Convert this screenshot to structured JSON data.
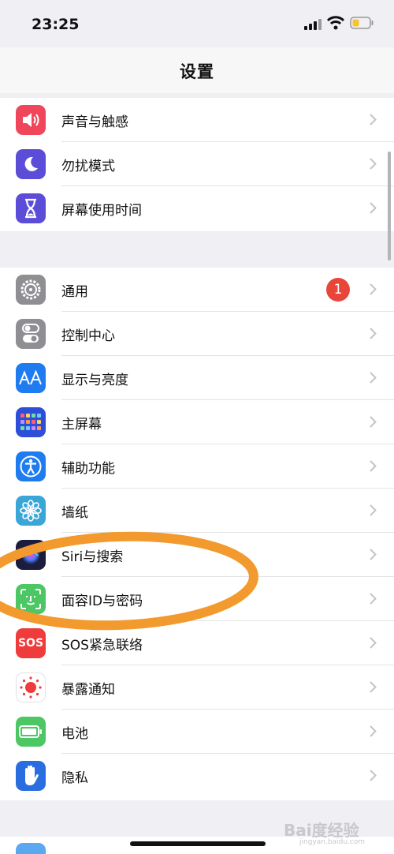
{
  "status_bar": {
    "time": "23:25"
  },
  "nav": {
    "title": "设置"
  },
  "group1": [
    {
      "label": "声音与触感",
      "icon": "speaker-icon",
      "color": "#f0465b"
    },
    {
      "label": "勿扰模式",
      "icon": "moon-icon",
      "color": "#5b4dd8"
    },
    {
      "label": "屏幕使用时间",
      "icon": "hourglass-icon",
      "color": "#5b4dd8"
    }
  ],
  "group2": [
    {
      "label": "通用",
      "icon": "gear-icon",
      "color": "#8e8e93",
      "badge": "1"
    },
    {
      "label": "控制中心",
      "icon": "toggles-icon",
      "color": "#8e8e93"
    },
    {
      "label": "显示与亮度",
      "icon": "text-size-icon",
      "color": "#1e7cf0"
    },
    {
      "label": "主屏幕",
      "icon": "app-grid-icon",
      "color": "#2d4ed8"
    },
    {
      "label": "辅助功能",
      "icon": "accessibility-icon",
      "color": "#1e7cf0"
    },
    {
      "label": "墙纸",
      "icon": "flower-icon",
      "color": "#3aa6d8"
    },
    {
      "label": "Siri与搜索",
      "icon": "siri-icon",
      "color": "#1c1c3c"
    },
    {
      "label": "面容ID与密码",
      "icon": "face-id-icon",
      "color": "#4cc764"
    },
    {
      "label": "SOS紧急联络",
      "icon": "sos-icon",
      "color": "#ef3b3b",
      "icon_text": "SOS"
    },
    {
      "label": "暴露通知",
      "icon": "exposure-icon",
      "color": "#ffffff"
    },
    {
      "label": "电池",
      "icon": "battery-icon",
      "color": "#4cc764"
    },
    {
      "label": "隐私",
      "icon": "hand-icon",
      "color": "#2a6de0"
    }
  ],
  "watermark": {
    "text": "Bai度经验",
    "sub": "jingyan.baidu.com"
  }
}
